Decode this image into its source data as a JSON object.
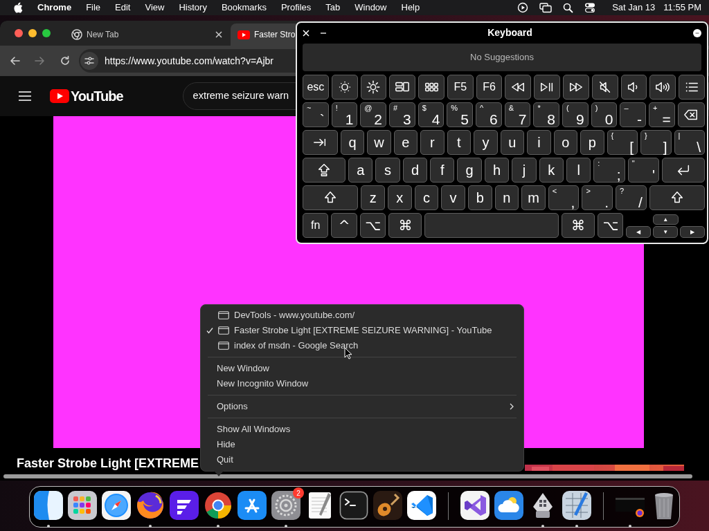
{
  "menu_bar": {
    "app": "Chrome",
    "items": [
      "File",
      "Edit",
      "View",
      "History",
      "Bookmarks",
      "Profiles",
      "Tab",
      "Window",
      "Help"
    ],
    "date": "Sat Jan 13",
    "time": "11:55 PM"
  },
  "browser": {
    "tabs": [
      {
        "kind": "newtab",
        "label": "New Tab",
        "selected": false,
        "close_button": true
      },
      {
        "kind": "site",
        "label": "Faster Stro",
        "selected": true,
        "close_button": false
      }
    ],
    "url": "https://www.youtube.com/watch?v=Ajbr",
    "logo_text": "YouTube",
    "search": "extreme seizure warn",
    "video_title": "Faster Strobe Light [EXTREME"
  },
  "keyboard": {
    "title": "Keyboard",
    "suggestions": "No Suggestions",
    "function_keys": [
      {
        "kind": "text",
        "label": "esc"
      },
      {
        "kind": "brightness-down"
      },
      {
        "kind": "brightness-up"
      },
      {
        "kind": "mission-control"
      },
      {
        "kind": "launchpad"
      },
      {
        "kind": "text",
        "label": "F5"
      },
      {
        "kind": "text",
        "label": "F6"
      },
      {
        "kind": "rewind"
      },
      {
        "kind": "play-pause"
      },
      {
        "kind": "fast-forward"
      },
      {
        "kind": "mute"
      },
      {
        "kind": "volume-down"
      },
      {
        "kind": "volume-up"
      },
      {
        "kind": "list"
      }
    ],
    "number_keys": [
      {
        "kind": "dual",
        "top": "~",
        "main": "`"
      },
      {
        "kind": "dual",
        "top": "!",
        "main": "1"
      },
      {
        "kind": "dual",
        "top": "@",
        "main": "2"
      },
      {
        "kind": "dual",
        "top": "#",
        "main": "3"
      },
      {
        "kind": "dual",
        "top": "$",
        "main": "4"
      },
      {
        "kind": "dual",
        "top": "%",
        "main": "5"
      },
      {
        "kind": "dual",
        "top": "^",
        "main": "6"
      },
      {
        "kind": "dual",
        "top": "&",
        "main": "7"
      },
      {
        "kind": "dual",
        "top": "*",
        "main": "8"
      },
      {
        "kind": "dual",
        "top": "(",
        "main": "9"
      },
      {
        "kind": "dual",
        "top": ")",
        "main": "0"
      },
      {
        "kind": "dual",
        "top": "–",
        "main": "-"
      },
      {
        "kind": "dual",
        "top": "+",
        "main": "="
      },
      {
        "kind": "delete"
      }
    ],
    "upper_letter_keys": [
      {
        "kind": "tab"
      },
      {
        "kind": "char",
        "label": "q"
      },
      {
        "kind": "char",
        "label": "w"
      },
      {
        "kind": "char",
        "label": "e"
      },
      {
        "kind": "char",
        "label": "r"
      },
      {
        "kind": "char",
        "label": "t"
      },
      {
        "kind": "char",
        "label": "y"
      },
      {
        "kind": "char",
        "label": "u"
      },
      {
        "kind": "char",
        "label": "i"
      },
      {
        "kind": "char",
        "label": "o"
      },
      {
        "kind": "char",
        "label": "p"
      },
      {
        "kind": "dual",
        "top": "{",
        "main": "["
      },
      {
        "kind": "dual",
        "top": "}",
        "main": "]"
      },
      {
        "kind": "dual",
        "top": "|",
        "main": "\\"
      }
    ],
    "middle_letter_keys": [
      {
        "kind": "caps"
      },
      {
        "kind": "char",
        "label": "a"
      },
      {
        "kind": "char",
        "label": "s"
      },
      {
        "kind": "char",
        "label": "d"
      },
      {
        "kind": "char",
        "label": "f"
      },
      {
        "kind": "char",
        "label": "g"
      },
      {
        "kind": "char",
        "label": "h"
      },
      {
        "kind": "char",
        "label": "j"
      },
      {
        "kind": "char",
        "label": "k"
      },
      {
        "kind": "char",
        "label": "l"
      },
      {
        "kind": "dual",
        "top": ":",
        "main": ";"
      },
      {
        "kind": "dual",
        "top": "\"",
        "main": "'"
      },
      {
        "kind": "return"
      }
    ],
    "lower_letter_keys": [
      {
        "kind": "shift"
      },
      {
        "kind": "char",
        "label": "z"
      },
      {
        "kind": "char",
        "label": "x"
      },
      {
        "kind": "char",
        "label": "c"
      },
      {
        "kind": "char",
        "label": "v"
      },
      {
        "kind": "char",
        "label": "b"
      },
      {
        "kind": "char",
        "label": "n"
      },
      {
        "kind": "char",
        "label": "m"
      },
      {
        "kind": "dual",
        "top": "<",
        "main": ","
      },
      {
        "kind": "dual",
        "top": ">",
        "main": "."
      },
      {
        "kind": "dual",
        "top": "?",
        "main": "/"
      },
      {
        "kind": "shift"
      }
    ],
    "modifier_keys": [
      {
        "kind": "text",
        "label": "fn"
      },
      {
        "kind": "mod",
        "label": "^"
      },
      {
        "kind": "mod",
        "label": "⌥"
      },
      {
        "kind": "command",
        "label": "⌘"
      },
      {
        "kind": "space"
      },
      {
        "kind": "command",
        "label": "⌘"
      },
      {
        "kind": "mod",
        "label": "⌥"
      },
      {
        "kind": "arrows",
        "up": "▲",
        "left": "◀",
        "down": "▼",
        "right": "▶"
      }
    ]
  },
  "context_menu": {
    "items": [
      {
        "kind": "window",
        "label": "DevTools - www.youtube.com/",
        "checked": false
      },
      {
        "kind": "window",
        "label": "Faster Strobe Light [EXTREME SEIZURE WARNING] - YouTube",
        "checked": true
      },
      {
        "kind": "window",
        "label": "index of msdn - Google Search",
        "checked": false
      },
      {
        "kind": "separator"
      },
      {
        "kind": "item",
        "label": "New Window"
      },
      {
        "kind": "item",
        "label": "New Incognito Window"
      },
      {
        "kind": "separator"
      },
      {
        "kind": "submenu",
        "label": "Options"
      },
      {
        "kind": "separator"
      },
      {
        "kind": "item",
        "label": "Show All Windows"
      },
      {
        "kind": "item",
        "label": "Hide"
      },
      {
        "kind": "item",
        "label": "Quit"
      }
    ]
  },
  "dock": {
    "apps": [
      {
        "running": true
      },
      {
        "running": false
      },
      {
        "running": false
      },
      {
        "running": true
      },
      {
        "running": false
      },
      {
        "running": true
      },
      {
        "running": false
      },
      {
        "running": true,
        "badge": "2"
      },
      {
        "running": false
      },
      {
        "running": false
      },
      {
        "running": false
      },
      {
        "running": false
      },
      {
        "running": false
      },
      {
        "running": false
      },
      {
        "running": true
      },
      {
        "running": true
      },
      {
        "running": true
      },
      {
        "running": false
      }
    ]
  }
}
